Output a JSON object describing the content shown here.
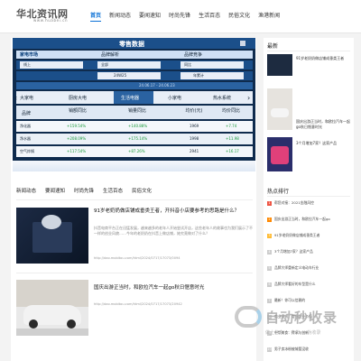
{
  "site": {
    "logo": "华北资讯网",
    "url": "www.huabei.cn"
  },
  "nav": [
    "首页",
    "新闻动态",
    "要闻速知",
    "时尚先锋",
    "生活百态",
    "民俗文化",
    "渔港新闻"
  ],
  "banner": {
    "title": "零售数据",
    "tabs": [
      "家电市场",
      "品牌解析",
      "品牌竞争"
    ],
    "filters": [
      "线上",
      "全部",
      "同比"
    ],
    "week": "24W25",
    "period": "年累计",
    "date_range": "24.06.17 - 24.06.23",
    "cats": [
      "大家电",
      "厨房大电",
      "生活电器",
      "小家电",
      "热水系统"
    ],
    "col_heads": [
      "品牌",
      "销额同比",
      "销量同比",
      "均价(元)",
      "均价同比"
    ],
    "rows": [
      {
        "brand": "净化器",
        "c1": "+159.54%",
        "c2": "+140.88%",
        "c3": "1969",
        "c4": "+7.74"
      },
      {
        "brand": "净水器",
        "c1": "+208.09%",
        "c2": "+175.14%",
        "c3": "1998",
        "c4": "+11.98"
      },
      {
        "brand": "空气炸锅",
        "c1": "+117.54%",
        "c2": "+87.26%",
        "c3": "2941",
        "c4": "+16.17"
      }
    ]
  },
  "tabs2": [
    "新闻动态",
    "要闻速知",
    "时尚先锋",
    "生活百态",
    "民俗文化"
  ],
  "articles": [
    {
      "title": "91岁老奶奶做店铺成垂类王者，开抖音小店要参考的思路是什么？",
      "desc": "抖音电商平台正在迅猛发展，越来越多的老年人开始尝试开店，这些老年人的故事也为我们展示了不一样的创业风貌……今年的老奶奶在抖音上做店铺，她究竟做对了什么？",
      "url": "http://dao.mobitou.com/html/2024/0717/17073/0094"
    },
    {
      "title": "国庆出游正当时，和欧拉汽车一起go秋日惬意时光",
      "desc": "",
      "url": "http://dao.mobitou.com/html/2024/0717/17073/20942"
    }
  ],
  "sidebar": {
    "latest": "最新",
    "items": [
      "91岁老奶奶做店铺成垂类王者",
      "国庆出游正当时，和欧拉汽车一起go秋日惬意时光",
      "3个月增加7家？这家产品"
    ],
    "hot": "热点排行",
    "hot_items": [
      "帮您对接：2021金融风控",
      "国庆出游正当时，和欧拉汽车一起go",
      "91岁老奶奶做店铺成垂类王者",
      "3个月增加7家？这家产品",
      "品牌大师重新定义电动车行业",
      "品牌大师看好的车型是什么",
      "最新！你可以信赖的",
      "商业资讯：提升企业价值",
      "中华美食：传承与创新",
      "男子卖冰粉被城管没收"
    ]
  },
  "watermark": {
    "text": "自动秒收录",
    "sub": "做上信息 一 奏份 一 伪收录"
  }
}
